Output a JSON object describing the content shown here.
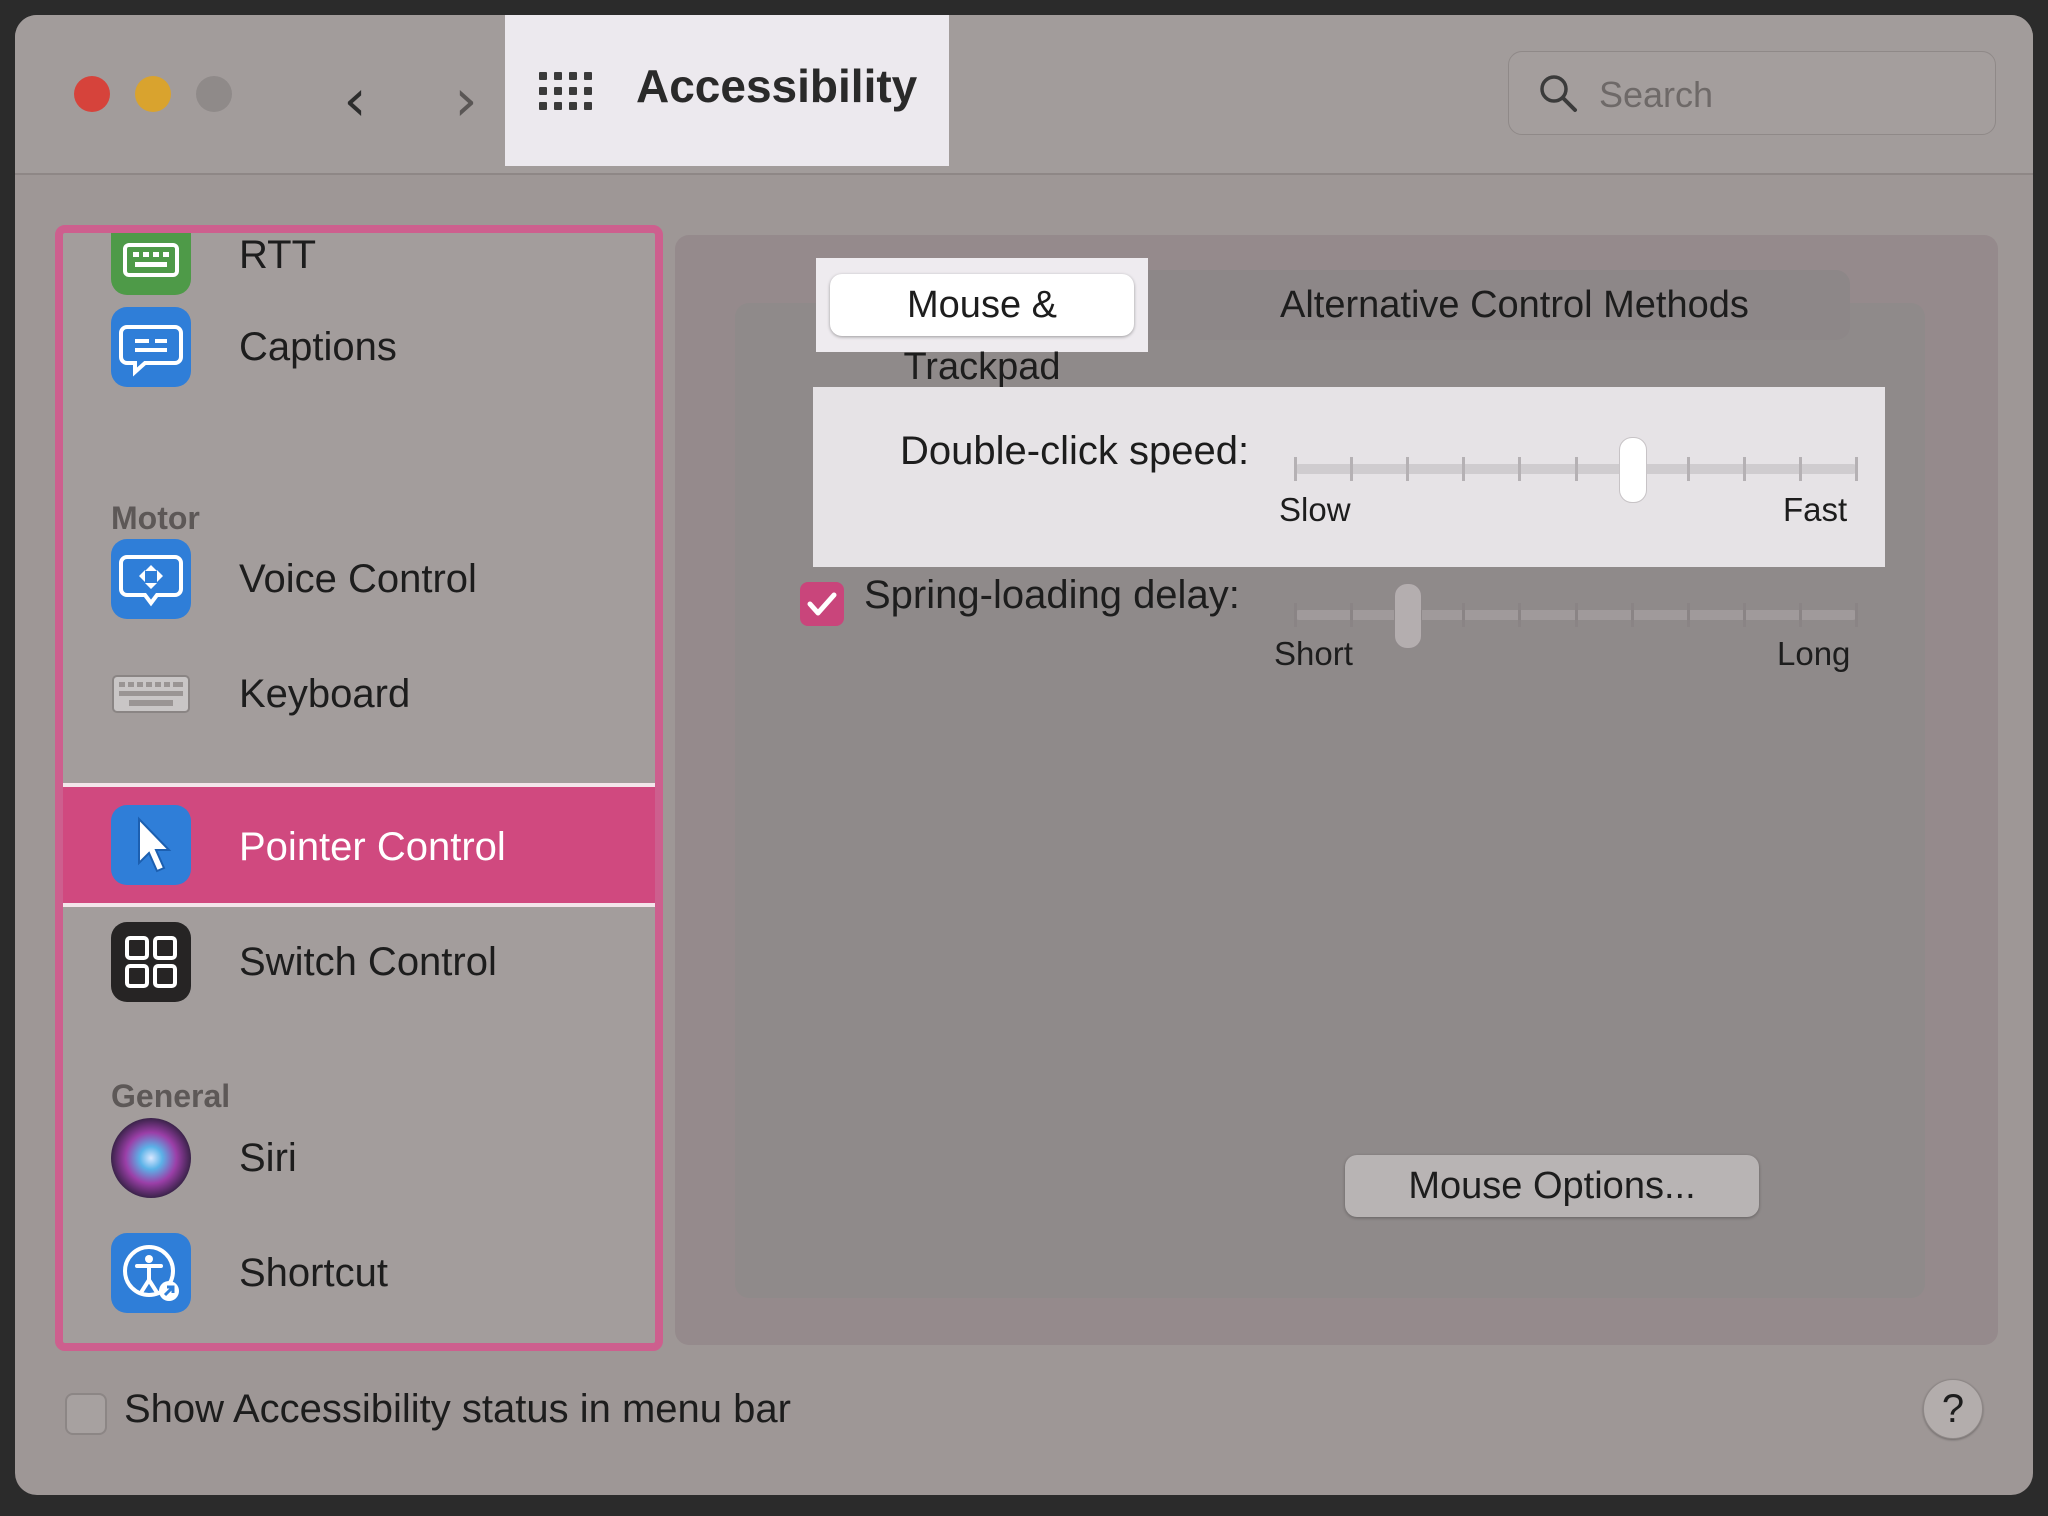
{
  "window": {
    "title": "Accessibility",
    "search_placeholder": "Search",
    "nav_back": "‹",
    "nav_forward": "›"
  },
  "sidebar": {
    "items": [
      {
        "label": "RTT",
        "icon": "rtt-icon"
      },
      {
        "label": "Captions",
        "icon": "captions-icon"
      },
      {
        "label": "Voice Control",
        "icon": "voice-control-icon"
      },
      {
        "label": "Keyboard",
        "icon": "keyboard-icon"
      },
      {
        "label": "Pointer Control",
        "icon": "pointer-icon",
        "selected": true
      },
      {
        "label": "Switch Control",
        "icon": "switch-control-icon"
      },
      {
        "label": "Siri",
        "icon": "siri-icon"
      },
      {
        "label": "Shortcut",
        "icon": "shortcut-icon"
      }
    ],
    "sections": {
      "motor": "Motor",
      "general": "General"
    }
  },
  "tabs": [
    {
      "label": "Mouse & Trackpad",
      "selected": true
    },
    {
      "label": "Alternative Control Methods",
      "selected": false
    }
  ],
  "settings": {
    "double_click": {
      "label": "Double-click speed:",
      "min_label": "Slow",
      "max_label": "Fast",
      "value_fraction": 0.6,
      "tick_count": 11
    },
    "spring_loading": {
      "label": "Spring-loading delay:",
      "checked": true,
      "min_label": "Short",
      "max_label": "Long",
      "value_fraction": 0.2,
      "tick_count": 11
    },
    "mouse_options_button": "Mouse Options..."
  },
  "footer": {
    "status_checkbox_label": "Show Accessibility status in menu bar",
    "status_checked": false,
    "help_label": "?"
  },
  "colors": {
    "accent": "#d0497f",
    "highlight_border": "#cd5f8e",
    "close": "#d6433b",
    "minimize": "#d9a32e",
    "zoom_disabled": "#8f8a89"
  }
}
